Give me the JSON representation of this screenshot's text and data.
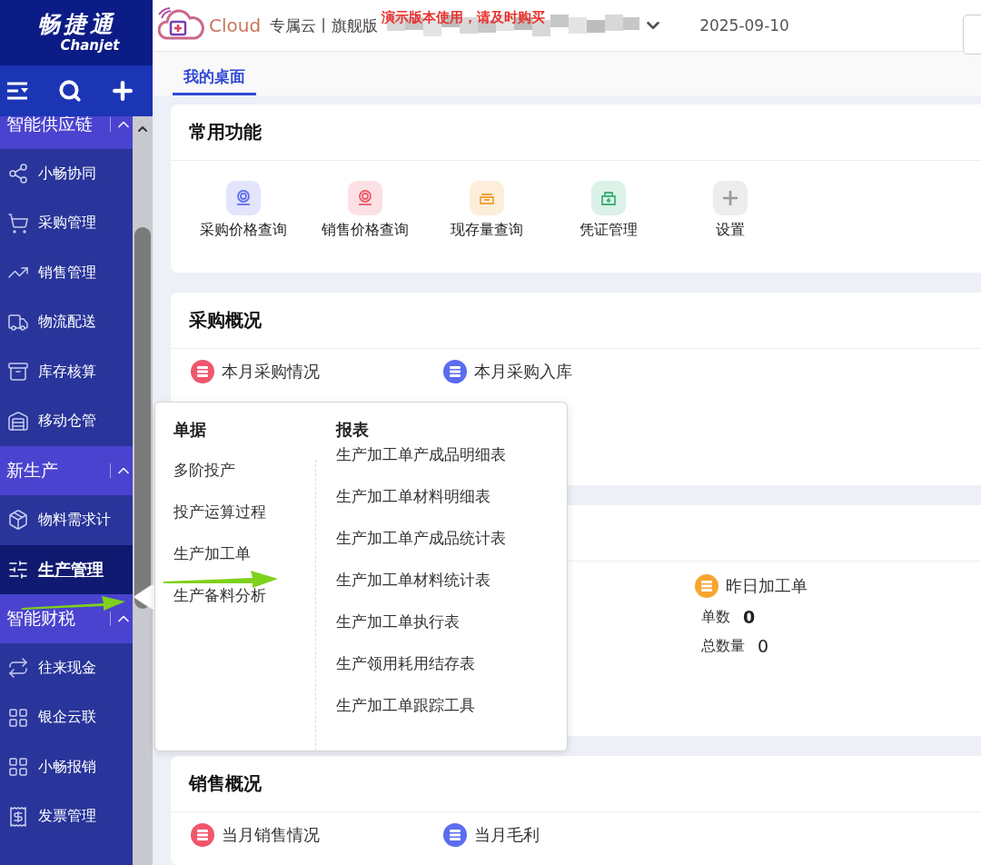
{
  "brand": {
    "name": "畅捷通",
    "latin": "Chanjet"
  },
  "header": {
    "product": "Cloud",
    "edition": "专属云丨旗舰版",
    "demo_notice": "演示版本使用，请及时购买",
    "date": "2025-09-10"
  },
  "tabs": [
    {
      "label": "我的桌面",
      "selected": true
    }
  ],
  "sidebar": {
    "groups": [
      {
        "title": "智能供应链",
        "expanded": true,
        "items": [
          {
            "label": "小畅协同",
            "selected": false
          },
          {
            "label": "采购管理",
            "selected": false
          },
          {
            "label": "销售管理",
            "selected": false
          },
          {
            "label": "物流配送",
            "selected": false
          },
          {
            "label": "库存核算",
            "selected": false
          },
          {
            "label": "移动仓管",
            "selected": false
          }
        ]
      },
      {
        "title": "新生产",
        "expanded": true,
        "items": [
          {
            "label": "物料需求计",
            "selected": false
          },
          {
            "label": "生产管理",
            "selected": true
          }
        ]
      },
      {
        "title": "智能财税",
        "expanded": true,
        "items": [
          {
            "label": "往来现金",
            "selected": false
          },
          {
            "label": "银企云联",
            "selected": false
          },
          {
            "label": "小畅报销",
            "selected": false
          },
          {
            "label": "发票管理",
            "selected": false
          }
        ]
      }
    ]
  },
  "quick_functions": {
    "title": "常用功能",
    "items": [
      {
        "label": "采购价格查询",
        "color": "#6170ee"
      },
      {
        "label": "销售价格查询",
        "color": "#ec5b6b"
      },
      {
        "label": "现存量查询",
        "color": "#f2a33a"
      },
      {
        "label": "凭证管理",
        "color": "#3fb37a"
      },
      {
        "label": "设置",
        "color": "#9a9a9a"
      }
    ]
  },
  "purchase_overview": {
    "title": "采购概况",
    "stats": [
      {
        "label": "本月采购情况",
        "color": "#f0566d"
      },
      {
        "label": "本月采购入库",
        "color": "#5b6cf0"
      }
    ]
  },
  "production_overview": {
    "stat": {
      "label": "昨日加工单",
      "color": "#f7a531",
      "rows": [
        {
          "label": "单数",
          "value": "0",
          "emphasized": true
        },
        {
          "label": "总数量",
          "value": "0",
          "emphasized": false
        }
      ]
    }
  },
  "sales_overview": {
    "title": "销售概况",
    "stats": [
      {
        "label": "当月销售情况",
        "color": "#f0566d"
      },
      {
        "label": "当月毛利",
        "color": "#5b6cf0"
      }
    ]
  },
  "flyout_menu": {
    "columns": [
      {
        "title": "单据",
        "items": [
          "多阶投产",
          "投产运算过程",
          "生产加工单",
          "生产备料分析"
        ]
      },
      {
        "title": "报表",
        "items": [
          "生产加工单产成品明细表",
          "生产加工单材料明细表",
          "生产加工单产成品统计表",
          "生产加工单材料统计表",
          "生产加工单执行表",
          "生产领用耗用结存表",
          "生产加工单跟踪工具"
        ]
      }
    ]
  }
}
